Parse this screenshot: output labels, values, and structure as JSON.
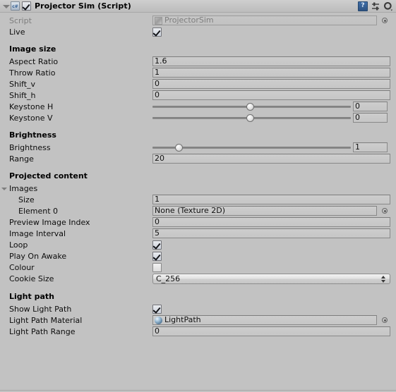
{
  "component": {
    "title": "Projector Sim (Script)",
    "enabled_checkbox": true,
    "script_icon": "csharp-script-icon",
    "header_icons": [
      "help-icon",
      "preset-icon",
      "gear-icon"
    ]
  },
  "rows": {
    "script": {
      "label": "Script",
      "value": "ProjectorSim"
    },
    "live": {
      "label": "Live",
      "checked": true
    }
  },
  "sections": {
    "image_size": "Image size",
    "brightness": "Brightness",
    "projected_content": "Projected content",
    "light_path": "Light path"
  },
  "image_size": {
    "aspect_ratio": {
      "label": "Aspect Ratio",
      "value": "1.6"
    },
    "throw_ratio": {
      "label": "Throw Ratio",
      "value": "1"
    },
    "shift_v": {
      "label": "Shift_v",
      "value": "0"
    },
    "shift_h": {
      "label": "Shift_h",
      "value": "0"
    },
    "keystone_h": {
      "label": "Keystone H",
      "value": "0",
      "slider_pct": 49
    },
    "keystone_v": {
      "label": "Keystone V",
      "value": "0",
      "slider_pct": 49
    }
  },
  "brightness_group": {
    "brightness": {
      "label": "Brightness",
      "value": "1",
      "slider_pct": 13
    },
    "range": {
      "label": "Range",
      "value": "20"
    }
  },
  "projected_content": {
    "images": {
      "label": "Images",
      "expanded": true
    },
    "size": {
      "label": "Size",
      "value": "1"
    },
    "element_0": {
      "label": "Element 0",
      "value": "None (Texture 2D)"
    },
    "preview_image_index": {
      "label": "Preview Image Index",
      "value": "0"
    },
    "image_interval": {
      "label": "Image Interval",
      "value": "5"
    },
    "loop": {
      "label": "Loop",
      "checked": true
    },
    "play_on_awake": {
      "label": "Play On Awake",
      "checked": true
    },
    "colour": {
      "label": "Colour",
      "swatch": "#f0f0f0"
    },
    "cookie_size": {
      "label": "Cookie Size",
      "value": "C_256"
    }
  },
  "light_path": {
    "show_light_path": {
      "label": "Show Light Path",
      "checked": true
    },
    "light_path_material": {
      "label": "Light Path Material",
      "value": "LightPath"
    },
    "light_path_range": {
      "label": "Light Path Range",
      "value": "0"
    }
  }
}
